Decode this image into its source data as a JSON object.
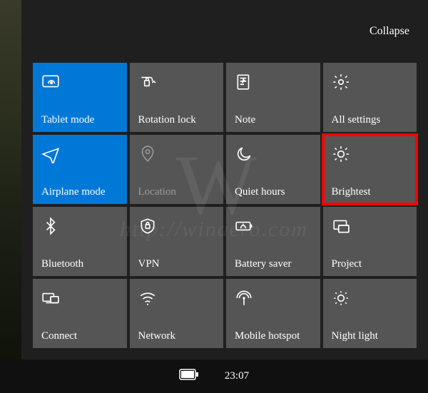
{
  "header": {
    "collapse_label": "Collapse"
  },
  "tiles": {
    "t0": {
      "label": "Tablet mode"
    },
    "t1": {
      "label": "Rotation lock"
    },
    "t2": {
      "label": "Note"
    },
    "t3": {
      "label": "All settings"
    },
    "t4": {
      "label": "Airplane mode"
    },
    "t5": {
      "label": "Location"
    },
    "t6": {
      "label": "Quiet hours"
    },
    "t7": {
      "label": "Brightest"
    },
    "t8": {
      "label": "Bluetooth"
    },
    "t9": {
      "label": "VPN"
    },
    "t10": {
      "label": "Battery saver"
    },
    "t11": {
      "label": "Project"
    },
    "t12": {
      "label": "Connect"
    },
    "t13": {
      "label": "Network"
    },
    "t14": {
      "label": "Mobile hotspot"
    },
    "t15": {
      "label": "Night light"
    }
  },
  "taskbar": {
    "time": "23:07"
  },
  "watermark": {
    "logo": "W",
    "url": "http://winaero.com"
  }
}
